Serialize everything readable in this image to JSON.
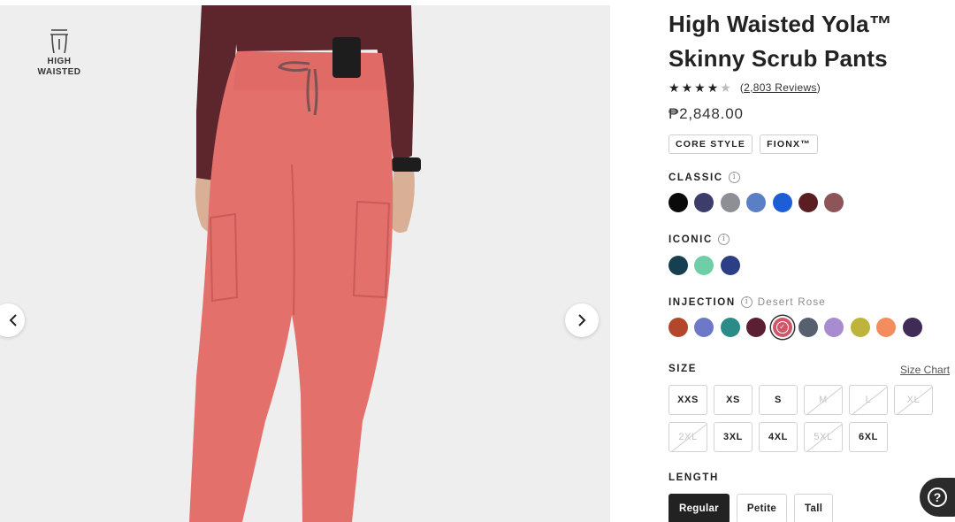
{
  "badge": {
    "line1": "HIGH",
    "line2": "WAISTED",
    "icon": "waist-icon"
  },
  "product": {
    "title_line1": "High Waisted Yola™",
    "title_line2": "Skinny Scrub Pants",
    "rating": 4.5,
    "reviews_text": "2,803 Reviews",
    "price": "₱2,848.00",
    "tags": [
      "CORE STYLE",
      "FIONX™"
    ]
  },
  "colors": {
    "classic": {
      "label": "CLASSIC",
      "swatches": [
        "#0a0a0a",
        "#3d3d6b",
        "#8e8e95",
        "#5b7fc4",
        "#1b5ed6",
        "#5a1e22",
        "#8e5559"
      ]
    },
    "iconic": {
      "label": "ICONIC",
      "swatches": [
        "#163f52",
        "#6fcea6",
        "#2c3f86"
      ]
    },
    "injection": {
      "label": "INJECTION",
      "selected_name": "Desert Rose",
      "swatches": [
        "#b3472b",
        "#6d78c8",
        "#2b8c87",
        "#5a1f33",
        "#d2566a",
        "#56606e",
        "#a88cd0",
        "#bdb43b",
        "#f38d5f",
        "#3f2b55"
      ],
      "selected_index": 4
    }
  },
  "size": {
    "label": "SIZE",
    "chart_link": "Size Chart",
    "options": [
      {
        "label": "XXS",
        "available": true
      },
      {
        "label": "XS",
        "available": true
      },
      {
        "label": "S",
        "available": true
      },
      {
        "label": "M",
        "available": false
      },
      {
        "label": "L",
        "available": false
      },
      {
        "label": "XL",
        "available": false
      },
      {
        "label": "2XL",
        "available": false
      },
      {
        "label": "3XL",
        "available": true
      },
      {
        "label": "4XL",
        "available": true
      },
      {
        "label": "5XL",
        "available": false
      },
      {
        "label": "6XL",
        "available": true
      }
    ]
  },
  "length": {
    "label": "LENGTH",
    "options": [
      "Regular",
      "Petite",
      "Tall"
    ],
    "selected": "Regular"
  },
  "theme": {
    "pant_color": "#e4706c",
    "top_color": "#5d262c",
    "text_color": "#222222"
  }
}
